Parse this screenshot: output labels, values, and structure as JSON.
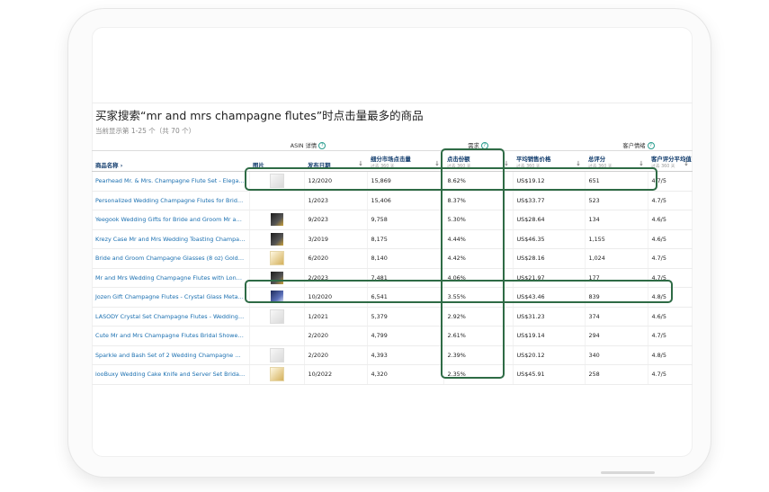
{
  "page": {
    "title": "买家搜索“mr and mrs champagne flutes”时点击量最多的商品",
    "subtitle": "当前显示第 1-25 个（共 70 个）"
  },
  "groups": {
    "asin": "ASIN 详情",
    "demand": "需求",
    "customer": "客户情绪"
  },
  "columns": {
    "name": {
      "label": "商品名称",
      "icon": "chevron-right-icon"
    },
    "image": {
      "label": "图片"
    },
    "date": {
      "label": "发布日期"
    },
    "niche_clicks": {
      "label": "细分市场点击量",
      "sub": "过去 360 天"
    },
    "click_share": {
      "label": "点击份额",
      "sub": "过去 360 天"
    },
    "avg_price": {
      "label": "平均销售价格",
      "sub": "过去 360 天"
    },
    "ratings": {
      "label": "总评分",
      "sub": "过去 360 天"
    },
    "avg_rating": {
      "label": "客户评分平均值",
      "sub": "过去 360 天"
    }
  },
  "rows": [
    {
      "name": "Pearhead Mr. & Mrs. Champagne Flute Set - Elegant His...",
      "thumb": "light",
      "date": "12/2020",
      "clicks": "15,869",
      "share": "8.62%",
      "price": "US$19.12",
      "ratings": "651",
      "avg": "4.7/5"
    },
    {
      "name": "Personalized Wedding Champagne Flutes for Bride and ...",
      "thumb": "none",
      "date": "1/2023",
      "clicks": "15,406",
      "share": "8.37%",
      "price": "US$33.77",
      "ratings": "523",
      "avg": "4.7/5"
    },
    {
      "name": "Yeegook Wedding Gifts for Bride and Groom Mr and Mr...",
      "thumb": "dark",
      "date": "9/2023",
      "clicks": "9,758",
      "share": "5.30%",
      "price": "US$28.64",
      "ratings": "134",
      "avg": "4.6/5"
    },
    {
      "name": "Krezy Case Mr and Mrs Wedding Toasting Champagne F...",
      "thumb": "dark",
      "date": "3/2019",
      "clicks": "8,175",
      "share": "4.44%",
      "price": "US$46.35",
      "ratings": "1,155",
      "avg": "4.6/5"
    },
    {
      "name": "Bride and Groom Champagne Glasses (8 oz) Gold Print ...",
      "thumb": "gold",
      "date": "6/2020",
      "clicks": "8,140",
      "share": "4.42%",
      "price": "US$28.16",
      "ratings": "1,024",
      "avg": "4.7/5"
    },
    {
      "name": "Mr and Mrs Wedding Champagne Flutes with Long Ste...",
      "thumb": "dark",
      "date": "2/2023",
      "clicks": "7,481",
      "share": "4.06%",
      "price": "US$21.97",
      "ratings": "177",
      "avg": "4.7/5"
    },
    {
      "name": "Jozen Gift Champagne Flutes - Crystal Glass Metal Base...",
      "thumb": "blue",
      "date": "10/2020",
      "clicks": "6,541",
      "share": "3.55%",
      "price": "US$43.46",
      "ratings": "839",
      "avg": "4.8/5"
    },
    {
      "name": "LASODY Crystal Set Champagne Flutes - Wedding Glas...",
      "thumb": "light",
      "date": "1/2021",
      "clicks": "5,379",
      "share": "2.92%",
      "price": "US$31.23",
      "ratings": "374",
      "avg": "4.6/5"
    },
    {
      "name": "Cute Mr and Mrs Champagne Flutes Bridal Shower Gift ...",
      "thumb": "none",
      "date": "2/2020",
      "clicks": "4,799",
      "share": "2.61%",
      "price": "US$19.14",
      "ratings": "294",
      "avg": "4.7/5"
    },
    {
      "name": "Sparkle and Bash Set of 2 Wedding Champagne Glasses...",
      "thumb": "light",
      "date": "2/2020",
      "clicks": "4,393",
      "share": "2.39%",
      "price": "US$20.12",
      "ratings": "340",
      "avg": "4.8/5"
    },
    {
      "name": "iooBuxy Wedding Cake Knife and Server Set Bridal Sho...",
      "thumb": "gold",
      "date": "10/2022",
      "clicks": "4,320",
      "share": "2.35%",
      "price": "US$45.91",
      "ratings": "258",
      "avg": "4.7/5"
    }
  ],
  "colors": {
    "highlight": "#2e6b45",
    "link": "#1a6fb0",
    "header": "#0f3a6b"
  }
}
